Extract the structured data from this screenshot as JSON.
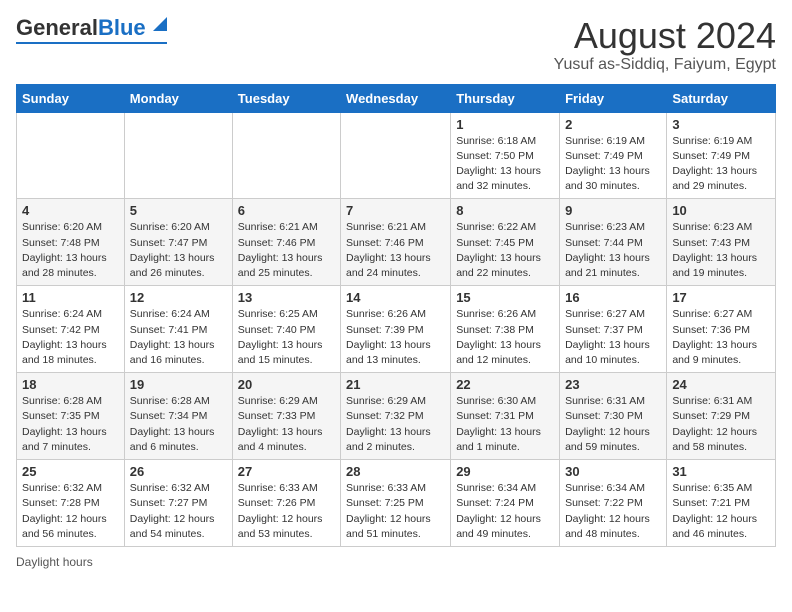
{
  "header": {
    "logo_general": "General",
    "logo_blue": "Blue",
    "month_year": "August 2024",
    "location": "Yusuf as-Siddiq, Faiyum, Egypt"
  },
  "weekdays": [
    "Sunday",
    "Monday",
    "Tuesday",
    "Wednesday",
    "Thursday",
    "Friday",
    "Saturday"
  ],
  "footer": {
    "label": "Daylight hours"
  },
  "weeks": [
    [
      {
        "day": "",
        "sunrise": "",
        "sunset": "",
        "daylight": ""
      },
      {
        "day": "",
        "sunrise": "",
        "sunset": "",
        "daylight": ""
      },
      {
        "day": "",
        "sunrise": "",
        "sunset": "",
        "daylight": ""
      },
      {
        "day": "",
        "sunrise": "",
        "sunset": "",
        "daylight": ""
      },
      {
        "day": "1",
        "sunrise": "Sunrise: 6:18 AM",
        "sunset": "Sunset: 7:50 PM",
        "daylight": "Daylight: 13 hours and 32 minutes."
      },
      {
        "day": "2",
        "sunrise": "Sunrise: 6:19 AM",
        "sunset": "Sunset: 7:49 PM",
        "daylight": "Daylight: 13 hours and 30 minutes."
      },
      {
        "day": "3",
        "sunrise": "Sunrise: 6:19 AM",
        "sunset": "Sunset: 7:49 PM",
        "daylight": "Daylight: 13 hours and 29 minutes."
      }
    ],
    [
      {
        "day": "4",
        "sunrise": "Sunrise: 6:20 AM",
        "sunset": "Sunset: 7:48 PM",
        "daylight": "Daylight: 13 hours and 28 minutes."
      },
      {
        "day": "5",
        "sunrise": "Sunrise: 6:20 AM",
        "sunset": "Sunset: 7:47 PM",
        "daylight": "Daylight: 13 hours and 26 minutes."
      },
      {
        "day": "6",
        "sunrise": "Sunrise: 6:21 AM",
        "sunset": "Sunset: 7:46 PM",
        "daylight": "Daylight: 13 hours and 25 minutes."
      },
      {
        "day": "7",
        "sunrise": "Sunrise: 6:21 AM",
        "sunset": "Sunset: 7:46 PM",
        "daylight": "Daylight: 13 hours and 24 minutes."
      },
      {
        "day": "8",
        "sunrise": "Sunrise: 6:22 AM",
        "sunset": "Sunset: 7:45 PM",
        "daylight": "Daylight: 13 hours and 22 minutes."
      },
      {
        "day": "9",
        "sunrise": "Sunrise: 6:23 AM",
        "sunset": "Sunset: 7:44 PM",
        "daylight": "Daylight: 13 hours and 21 minutes."
      },
      {
        "day": "10",
        "sunrise": "Sunrise: 6:23 AM",
        "sunset": "Sunset: 7:43 PM",
        "daylight": "Daylight: 13 hours and 19 minutes."
      }
    ],
    [
      {
        "day": "11",
        "sunrise": "Sunrise: 6:24 AM",
        "sunset": "Sunset: 7:42 PM",
        "daylight": "Daylight: 13 hours and 18 minutes."
      },
      {
        "day": "12",
        "sunrise": "Sunrise: 6:24 AM",
        "sunset": "Sunset: 7:41 PM",
        "daylight": "Daylight: 13 hours and 16 minutes."
      },
      {
        "day": "13",
        "sunrise": "Sunrise: 6:25 AM",
        "sunset": "Sunset: 7:40 PM",
        "daylight": "Daylight: 13 hours and 15 minutes."
      },
      {
        "day": "14",
        "sunrise": "Sunrise: 6:26 AM",
        "sunset": "Sunset: 7:39 PM",
        "daylight": "Daylight: 13 hours and 13 minutes."
      },
      {
        "day": "15",
        "sunrise": "Sunrise: 6:26 AM",
        "sunset": "Sunset: 7:38 PM",
        "daylight": "Daylight: 13 hours and 12 minutes."
      },
      {
        "day": "16",
        "sunrise": "Sunrise: 6:27 AM",
        "sunset": "Sunset: 7:37 PM",
        "daylight": "Daylight: 13 hours and 10 minutes."
      },
      {
        "day": "17",
        "sunrise": "Sunrise: 6:27 AM",
        "sunset": "Sunset: 7:36 PM",
        "daylight": "Daylight: 13 hours and 9 minutes."
      }
    ],
    [
      {
        "day": "18",
        "sunrise": "Sunrise: 6:28 AM",
        "sunset": "Sunset: 7:35 PM",
        "daylight": "Daylight: 13 hours and 7 minutes."
      },
      {
        "day": "19",
        "sunrise": "Sunrise: 6:28 AM",
        "sunset": "Sunset: 7:34 PM",
        "daylight": "Daylight: 13 hours and 6 minutes."
      },
      {
        "day": "20",
        "sunrise": "Sunrise: 6:29 AM",
        "sunset": "Sunset: 7:33 PM",
        "daylight": "Daylight: 13 hours and 4 minutes."
      },
      {
        "day": "21",
        "sunrise": "Sunrise: 6:29 AM",
        "sunset": "Sunset: 7:32 PM",
        "daylight": "Daylight: 13 hours and 2 minutes."
      },
      {
        "day": "22",
        "sunrise": "Sunrise: 6:30 AM",
        "sunset": "Sunset: 7:31 PM",
        "daylight": "Daylight: 13 hours and 1 minute."
      },
      {
        "day": "23",
        "sunrise": "Sunrise: 6:31 AM",
        "sunset": "Sunset: 7:30 PM",
        "daylight": "Daylight: 12 hours and 59 minutes."
      },
      {
        "day": "24",
        "sunrise": "Sunrise: 6:31 AM",
        "sunset": "Sunset: 7:29 PM",
        "daylight": "Daylight: 12 hours and 58 minutes."
      }
    ],
    [
      {
        "day": "25",
        "sunrise": "Sunrise: 6:32 AM",
        "sunset": "Sunset: 7:28 PM",
        "daylight": "Daylight: 12 hours and 56 minutes."
      },
      {
        "day": "26",
        "sunrise": "Sunrise: 6:32 AM",
        "sunset": "Sunset: 7:27 PM",
        "daylight": "Daylight: 12 hours and 54 minutes."
      },
      {
        "day": "27",
        "sunrise": "Sunrise: 6:33 AM",
        "sunset": "Sunset: 7:26 PM",
        "daylight": "Daylight: 12 hours and 53 minutes."
      },
      {
        "day": "28",
        "sunrise": "Sunrise: 6:33 AM",
        "sunset": "Sunset: 7:25 PM",
        "daylight": "Daylight: 12 hours and 51 minutes."
      },
      {
        "day": "29",
        "sunrise": "Sunrise: 6:34 AM",
        "sunset": "Sunset: 7:24 PM",
        "daylight": "Daylight: 12 hours and 49 minutes."
      },
      {
        "day": "30",
        "sunrise": "Sunrise: 6:34 AM",
        "sunset": "Sunset: 7:22 PM",
        "daylight": "Daylight: 12 hours and 48 minutes."
      },
      {
        "day": "31",
        "sunrise": "Sunrise: 6:35 AM",
        "sunset": "Sunset: 7:21 PM",
        "daylight": "Daylight: 12 hours and 46 minutes."
      }
    ]
  ]
}
